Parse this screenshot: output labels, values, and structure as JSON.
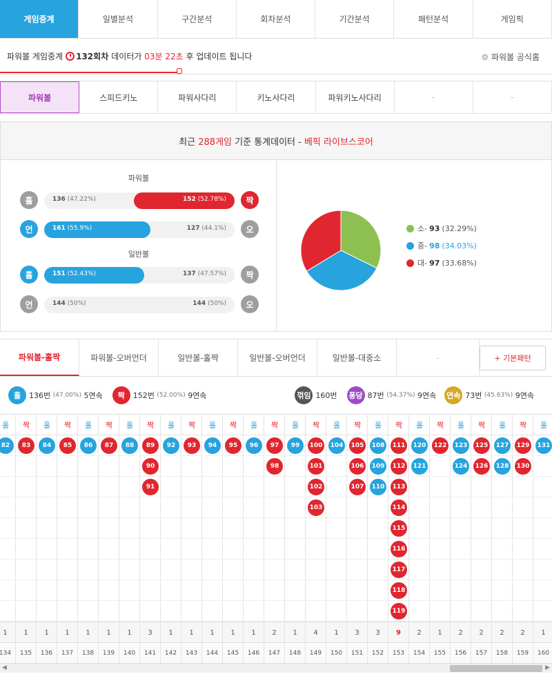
{
  "top_tabs": [
    "게임중계",
    "일별분석",
    "구간분석",
    "회차분석",
    "기간분석",
    "패턴분석",
    "게임픽"
  ],
  "info": {
    "prefix": "파워볼 게임중계",
    "round": "132회차",
    "mid": "데이터가",
    "time": "03분 22초",
    "suffix": "후 업데이트 됩니다",
    "official": "파워볼 공식홈"
  },
  "game_tabs": [
    "파워볼",
    "스피드키노",
    "파워사다리",
    "키노사다리",
    "파워키노사다리",
    "-",
    "-"
  ],
  "stats_header": {
    "prefix": "최근",
    "count": "288게임",
    "mid": "기준 통계데이터 -",
    "brand": "베픽 라이브스코어"
  },
  "powerball_label": "파워볼",
  "normal_label": "일반볼",
  "rows": [
    {
      "left": "홀",
      "right": "짝",
      "left_color": "#9e9e9e",
      "right_color": "#e0262f",
      "fill_side": "right",
      "fill_color": "#e0262f",
      "fill_pct": 52.78,
      "left_val": "136",
      "left_pct": "(47.22%)",
      "right_val": "152",
      "right_pct": "(52.78%)"
    },
    {
      "left": "언",
      "right": "오",
      "left_color": "#27a3de",
      "right_color": "#9e9e9e",
      "fill_side": "left",
      "fill_color": "#27a3de",
      "fill_pct": 55.9,
      "left_val": "161",
      "left_pct": "(55.9%)",
      "right_val": "127",
      "right_pct": "(44.1%)"
    },
    {
      "left": "홀",
      "right": "짝",
      "left_color": "#27a3de",
      "right_color": "#9e9e9e",
      "fill_side": "left",
      "fill_color": "#27a3de",
      "fill_pct": 52.43,
      "left_val": "151",
      "left_pct": "(52.43%)",
      "right_val": "137",
      "right_pct": "(47.57%)"
    },
    {
      "left": "언",
      "right": "오",
      "left_color": "#9e9e9e",
      "right_color": "#9e9e9e",
      "fill_side": "none",
      "fill_color": "#f1f1f1",
      "fill_pct": 50,
      "left_val": "144",
      "left_pct": "(50%)",
      "right_val": "144",
      "right_pct": "(50%)"
    }
  ],
  "chart_data": {
    "type": "pie",
    "categories": [
      "소",
      "중",
      "대"
    ],
    "values": [
      93,
      98,
      97
    ],
    "percents": [
      "(32.29%)",
      "(34.03%)",
      "(33.68%)"
    ],
    "colors": [
      "#8cc152",
      "#27a3de",
      "#e0262f"
    ]
  },
  "sub_tabs": [
    "파워볼-홀짝",
    "파워볼-오버언더",
    "일반볼-홀짝",
    "일반볼-오버언더",
    "일반볼-대중소",
    "-"
  ],
  "basic_pattern": "+ 기본패턴",
  "summary": {
    "odd": {
      "label": "홀",
      "count": "136번",
      "pct": "(47.00%)",
      "streak": "5연속"
    },
    "even": {
      "label": "짝",
      "count": "152번",
      "pct": "(52.00%)",
      "streak": "9연속"
    },
    "turn": {
      "label": "꺾임",
      "count": "160번"
    },
    "pong": {
      "label": "퐁당",
      "count": "87번",
      "pct": "(54.37%)",
      "streak": "9연속"
    },
    "cont": {
      "label": "연속",
      "count": "73번",
      "pct": "(45.63%)",
      "streak": "9연속"
    }
  },
  "columns": [
    {
      "h": "홀",
      "n": [
        "82"
      ],
      "c": "1",
      "r": "134"
    },
    {
      "h": "짝",
      "n": [
        "83"
      ],
      "c": "1",
      "r": "135"
    },
    {
      "h": "홀",
      "n": [
        "84"
      ],
      "c": "1",
      "r": "136"
    },
    {
      "h": "짝",
      "n": [
        "85"
      ],
      "c": "1",
      "r": "137"
    },
    {
      "h": "홀",
      "n": [
        "86"
      ],
      "c": "1",
      "r": "138"
    },
    {
      "h": "짝",
      "n": [
        "87"
      ],
      "c": "1",
      "r": "139"
    },
    {
      "h": "홀",
      "n": [
        "88"
      ],
      "c": "1",
      "r": "140"
    },
    {
      "h": "짝",
      "n": [
        "89",
        "90",
        "91"
      ],
      "c": "3",
      "r": "141"
    },
    {
      "h": "홀",
      "n": [
        "92"
      ],
      "c": "1",
      "r": "142"
    },
    {
      "h": "짝",
      "n": [
        "93"
      ],
      "c": "1",
      "r": "143"
    },
    {
      "h": "홀",
      "n": [
        "94"
      ],
      "c": "1",
      "r": "144"
    },
    {
      "h": "짝",
      "n": [
        "95"
      ],
      "c": "1",
      "r": "145"
    },
    {
      "h": "홀",
      "n": [
        "96"
      ],
      "c": "1",
      "r": "146"
    },
    {
      "h": "짝",
      "n": [
        "97",
        "98"
      ],
      "c": "2",
      "r": "147"
    },
    {
      "h": "홀",
      "n": [
        "99"
      ],
      "c": "1",
      "r": "148"
    },
    {
      "h": "짝",
      "n": [
        "100",
        "101",
        "102",
        "103"
      ],
      "c": "4",
      "r": "149"
    },
    {
      "h": "홀",
      "n": [
        "104"
      ],
      "c": "1",
      "r": "150"
    },
    {
      "h": "짝",
      "n": [
        "105",
        "106",
        "107"
      ],
      "c": "3",
      "r": "151"
    },
    {
      "h": "홀",
      "n": [
        "108",
        "109",
        "110"
      ],
      "c": "3",
      "r": "152"
    },
    {
      "h": "짝",
      "n": [
        "111",
        "112",
        "113",
        "114",
        "115",
        "116",
        "117",
        "118",
        "119"
      ],
      "c": "9",
      "r": "153"
    },
    {
      "h": "홀",
      "n": [
        "120",
        "121"
      ],
      "c": "2",
      "r": "154"
    },
    {
      "h": "짝",
      "n": [
        "122"
      ],
      "c": "1",
      "r": "155"
    },
    {
      "h": "홀",
      "n": [
        "123",
        "124"
      ],
      "c": "2",
      "r": "156"
    },
    {
      "h": "짝",
      "n": [
        "125",
        "126"
      ],
      "c": "2",
      "r": "157"
    },
    {
      "h": "홀",
      "n": [
        "127",
        "128"
      ],
      "c": "2",
      "r": "158"
    },
    {
      "h": "짝",
      "n": [
        "129",
        "130"
      ],
      "c": "2",
      "r": "159"
    },
    {
      "h": "홀",
      "n": [
        "131"
      ],
      "c": "1",
      "r": "160"
    }
  ],
  "colors": {
    "odd": "#27a3de",
    "even": "#e0262f"
  }
}
